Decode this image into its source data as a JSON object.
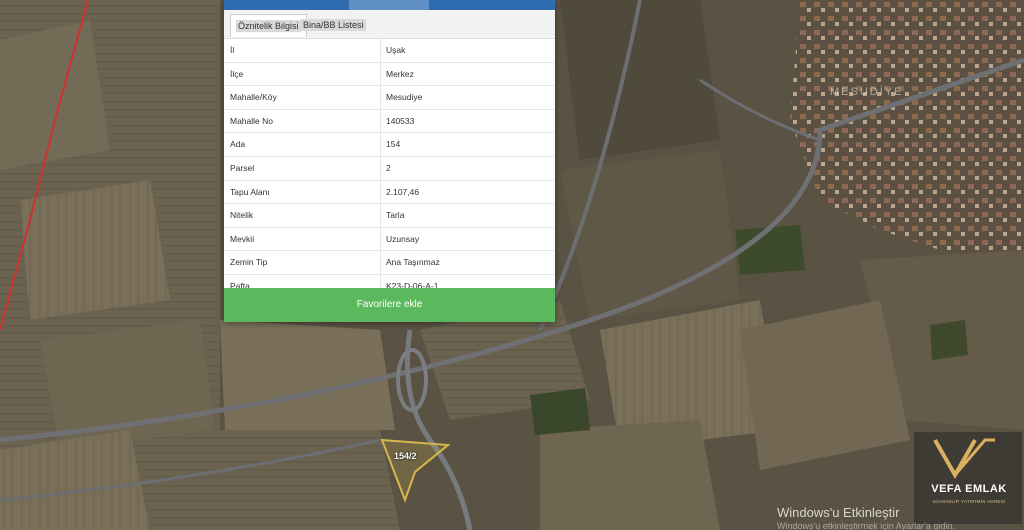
{
  "tabs": [
    {
      "label": "Öznitelik Bilgisi",
      "active": true
    },
    {
      "label": "Bina/BB Listesi",
      "active": false
    }
  ],
  "attributes": [
    {
      "key": "İl",
      "value": "Uşak"
    },
    {
      "key": "İlçe",
      "value": "Merkez"
    },
    {
      "key": "Mahalle/Köy",
      "value": "Mesudiye"
    },
    {
      "key": "Mahalle No",
      "value": "140533"
    },
    {
      "key": "Ada",
      "value": "154"
    },
    {
      "key": "Parsel",
      "value": "2"
    },
    {
      "key": "Tapu Alanı",
      "value": "2.107,46"
    },
    {
      "key": "Nitelik",
      "value": "Tarla"
    },
    {
      "key": "Mevkii",
      "value": "Uzunsay"
    },
    {
      "key": "Zemin Tip",
      "value": "Ana Taşınmaz"
    },
    {
      "key": "Pafta",
      "value": "K23-D-06-A-1"
    }
  ],
  "favorite_button": "Favorilere ekle",
  "map": {
    "parcel_label": "154/2",
    "village_label": "MESUDİYE",
    "highlight_color": "#d9b64a",
    "boundary_color": "#d03030"
  },
  "watermark": {
    "windows_title": "Windows'u Etkinleştir",
    "windows_sub": "Windows'u etkinleştirmek için Ayarlar'a gidin.",
    "brand": "VEFA EMLAK",
    "tagline": "GÜVENİLİR YATIRIMIN ADRESİ"
  },
  "colors": {
    "panel_header": "#2f6db0",
    "button": "#5cb85c"
  }
}
